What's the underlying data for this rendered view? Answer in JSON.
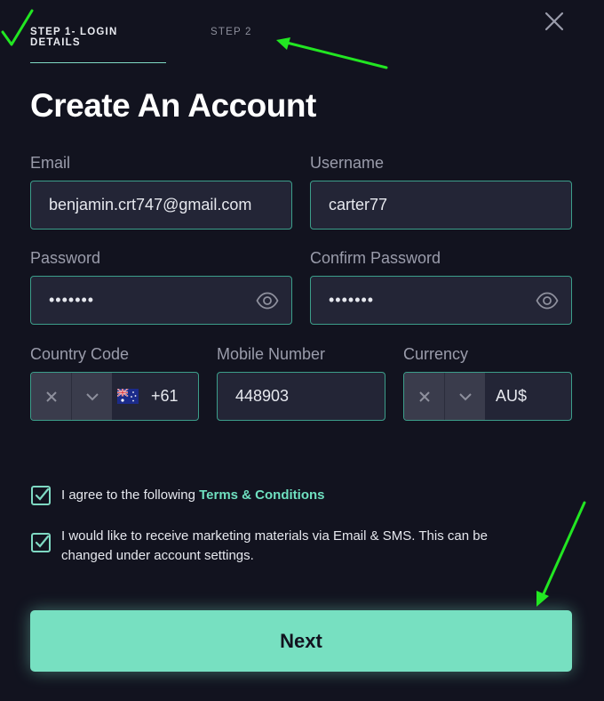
{
  "steps": {
    "step1": "STEP 1- LOGIN DETAILS",
    "step2": "STEP 2"
  },
  "title": "Create An Account",
  "fields": {
    "email": {
      "label": "Email",
      "value": "benjamin.crt747@gmail.com"
    },
    "username": {
      "label": "Username",
      "value": "carter77"
    },
    "password": {
      "label": "Password",
      "value": "•••••••"
    },
    "confirm_password": {
      "label": "Confirm Password",
      "value": "•••••••"
    },
    "country_code": {
      "label": "Country Code",
      "value": "+61"
    },
    "mobile": {
      "label": "Mobile Number",
      "value": "448903"
    },
    "currency": {
      "label": "Currency",
      "value": "AU$"
    }
  },
  "checkboxes": {
    "terms_prefix": "I agree to the following ",
    "terms_link": "Terms & Conditions",
    "marketing": "I would like to receive marketing materials via Email & SMS. This can be changed under account settings."
  },
  "next_label": "Next",
  "colors": {
    "background": "#12131f",
    "accent": "#77e0c1",
    "field_bg": "#232536",
    "field_border": "#3c9e8a",
    "annotation": "#22e622"
  }
}
